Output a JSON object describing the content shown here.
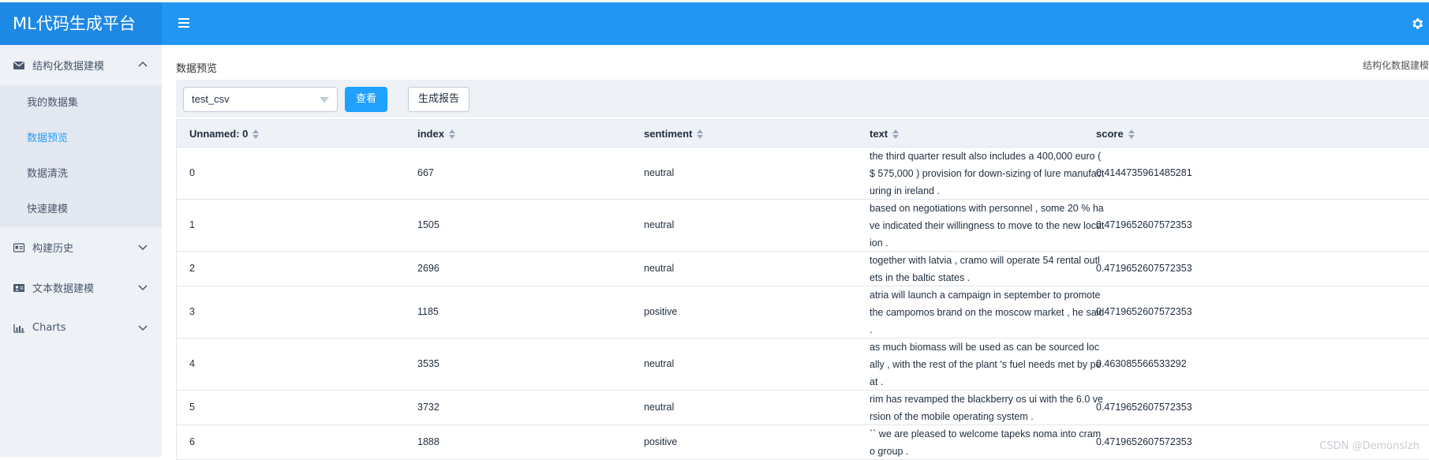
{
  "app": {
    "title": "ML代码生成平台"
  },
  "sidebar": {
    "groups": [
      {
        "label": "结构化数据建模",
        "icon": "envelope-icon",
        "expanded": true
      },
      {
        "label": "构建历史",
        "icon": "id-card-icon",
        "expanded": false
      },
      {
        "label": "文本数据建模",
        "icon": "contact-card-icon",
        "expanded": false
      },
      {
        "label": "Charts",
        "icon": "bar-chart-icon",
        "expanded": false
      }
    ],
    "items": [
      {
        "label": "我的数据集",
        "active": false
      },
      {
        "label": "数据预览",
        "active": true
      },
      {
        "label": "数据清洗",
        "active": false
      },
      {
        "label": "快速建模",
        "active": false
      }
    ]
  },
  "page": {
    "title": "数据预览",
    "breadcrumb": "结构化数据建模"
  },
  "toolbar": {
    "dataset_value": "test_csv",
    "view_label": "查看",
    "report_label": "生成报告"
  },
  "table": {
    "columns": [
      "Unnamed: 0",
      "index",
      "sentiment",
      "text",
      "score"
    ],
    "rows": [
      {
        "unnamed": "0",
        "index": "667",
        "sentiment": "neutral",
        "text": "the third quarter result also includes a 400,000 euro ( $ 575,000 ) provision for down-sizing of lure manufacturing in ireland .",
        "score": "0.4144735961485281"
      },
      {
        "unnamed": "1",
        "index": "1505",
        "sentiment": "neutral",
        "text": "based on negotiations with personnel , some 20 % have indicated their willingness to move to the new location .",
        "score": "0.4719652607572353"
      },
      {
        "unnamed": "2",
        "index": "2696",
        "sentiment": "neutral",
        "text": "together with latvia , cramo will operate 54 rental outlets in the baltic states .",
        "score": "0.4719652607572353"
      },
      {
        "unnamed": "3",
        "index": "1185",
        "sentiment": "positive",
        "text": "atria will launch a campaign in september to promote the campomos brand on the moscow market , he said .",
        "score": "0.4719652607572353"
      },
      {
        "unnamed": "4",
        "index": "3535",
        "sentiment": "neutral",
        "text": "as much biomass will be used as can be sourced locally , with the rest of the plant 's fuel needs met by peat .",
        "score": "0.463085566533292"
      },
      {
        "unnamed": "5",
        "index": "3732",
        "sentiment": "neutral",
        "text": "rim has revamped the blackberry os ui with the 6.0 version of the mobile operating system .",
        "score": "0.4719652607572353"
      },
      {
        "unnamed": "6",
        "index": "1888",
        "sentiment": "positive",
        "text": "`` we are pleased to welcome tapeks noma into cramo group .",
        "score": "0.4719652607572353"
      }
    ]
  },
  "watermark": "CSDN @DemonsIzh",
  "colors": {
    "header": "#2196f3",
    "brand": "#1e88e5",
    "accent": "#20a0ff",
    "sidebar": "#eef1f6"
  }
}
